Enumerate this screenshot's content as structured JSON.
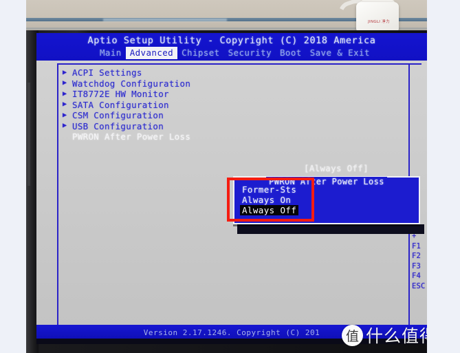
{
  "photo": {
    "device_label": "JINGLI 凈力",
    "device_name": "power-adapter"
  },
  "bios": {
    "title": "Aptio Setup Utility - Copyright (C) 2018 America",
    "tabs": [
      {
        "label": "Main",
        "active": false
      },
      {
        "label": "Advanced",
        "active": true
      },
      {
        "label": "Chipset",
        "active": false
      },
      {
        "label": "Security",
        "active": false
      },
      {
        "label": "Boot",
        "active": false
      },
      {
        "label": "Save & Exit",
        "active": false
      }
    ],
    "menu": [
      {
        "label": "ACPI Settings",
        "submenu": true,
        "selected": false
      },
      {
        "label": "Watchdog Configuration",
        "submenu": true,
        "selected": false
      },
      {
        "label": "IT8772E HW Monitor",
        "submenu": true,
        "selected": false
      },
      {
        "label": "SATA Configuration",
        "submenu": true,
        "selected": false
      },
      {
        "label": "CSM Configuration",
        "submenu": true,
        "selected": false
      },
      {
        "label": "USB Configuration",
        "submenu": true,
        "selected": false
      },
      {
        "label": "PWRON After Power Loss",
        "submenu": false,
        "selected": true
      }
    ],
    "current_value": "[Always Off]",
    "help_keys": [
      "+",
      "F1",
      "F2",
      "F3",
      "F4",
      "ESC"
    ],
    "version": "Version 2.17.1246. Copyright (C) 201",
    "arrow_glyph": "▶"
  },
  "dialog": {
    "title": "PWRON After Power Loss",
    "options": [
      {
        "label": "Former-Sts",
        "highlighted": false
      },
      {
        "label": "Always On",
        "highlighted": false
      },
      {
        "label": "Always Off",
        "highlighted": true
      }
    ]
  },
  "annotation": {
    "color": "#f51c11",
    "shape": "rectangle"
  },
  "watermark": {
    "logo_char": "值",
    "text": "什么值得买"
  }
}
